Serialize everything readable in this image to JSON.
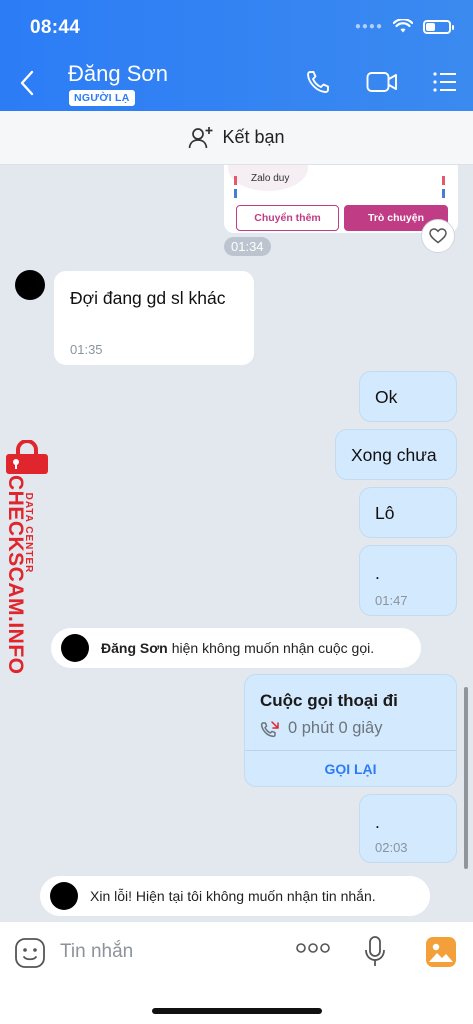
{
  "status_bar": {
    "time": "08:44"
  },
  "header": {
    "contact_name": "Đăng Sơn",
    "contact_tag": "NGƯỜI LẠ"
  },
  "friend_bar": {
    "label": "Kết bạn"
  },
  "shared_card": {
    "item_label": "Zalo duy",
    "forward_label": "Chuyển thêm",
    "chat_label": "Trò chuyện"
  },
  "messages": [
    {
      "time_pill": "01:34"
    },
    {
      "direction": "in",
      "text": "Đợi đang gd sl khác",
      "time": "01:35"
    },
    {
      "direction": "out",
      "text": "Ok"
    },
    {
      "direction": "out",
      "text": "Xong chưa"
    },
    {
      "direction": "out",
      "text": "Lô"
    },
    {
      "direction": "out",
      "text": ".",
      "time": "01:47"
    },
    {
      "system": true,
      "name": "Đăng Sơn",
      "text": "hiện không muốn nhận cuộc gọi."
    },
    {
      "call": true,
      "title": "Cuộc gọi thoại đi",
      "duration": "0 phút 0 giây",
      "action": "GỌI LẠI"
    },
    {
      "direction": "out",
      "text": ".",
      "time": "02:03"
    },
    {
      "system": true,
      "text": "Xin lỗi! Hiện tại tôi không muốn nhận tin nhắn."
    }
  ],
  "watermark": {
    "brand": "CHECKSCAM.INFO",
    "sub": "DATA CENTER"
  },
  "composer": {
    "placeholder": "Tin nhắn"
  },
  "colors": {
    "header_blue": "#2c7cf6",
    "bubble_out": "#d3e9fd",
    "card_accent": "#c03c85",
    "watermark_red": "#e0262c"
  },
  "icons": [
    "back-icon",
    "phone-icon",
    "video-call-icon",
    "menu-icon",
    "add-friend-icon",
    "heart-icon",
    "missed-call-icon",
    "emoji-icon",
    "more-icon",
    "mic-icon",
    "image-icon"
  ]
}
